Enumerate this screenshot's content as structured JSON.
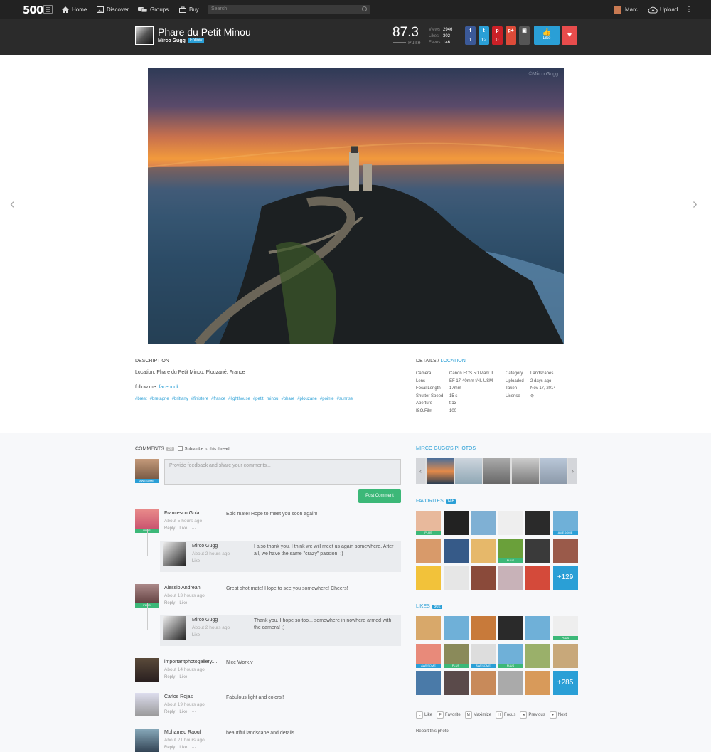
{
  "nav": {
    "logo": "500",
    "items": [
      "Home",
      "Discover",
      "Groups",
      "Buy"
    ],
    "search_placeholder": "Search",
    "user": "Marc",
    "upload": "Upload"
  },
  "photo": {
    "title": "Phare du Petit Minou",
    "author": "Mirco Gugg",
    "follow": "Follow",
    "pulse": "87.3",
    "pulse_label": "Pulse",
    "stats": [
      {
        "label": "Views",
        "value": "2946"
      },
      {
        "label": "Likes",
        "value": "302"
      },
      {
        "label": "Faves",
        "value": "146"
      }
    ],
    "share": [
      {
        "icon": "facebook-icon",
        "symbol": "f",
        "count": "1",
        "color": "#3b5998"
      },
      {
        "icon": "twitter-icon",
        "symbol": "t",
        "count": "12",
        "color": "#2a9fd6"
      },
      {
        "icon": "pinterest-icon",
        "symbol": "p",
        "count": "0",
        "color": "#cb2027"
      },
      {
        "icon": "googleplus-icon",
        "symbol": "g+",
        "count": "",
        "color": "#dd4b39"
      },
      {
        "icon": "embed-icon",
        "symbol": "▣",
        "count": "",
        "color": "#555"
      }
    ],
    "like": "Like",
    "watermark": "©Mirco Gugg"
  },
  "description": {
    "heading": "DESCRIPTION",
    "location": "Location: Phare du Petit Minou, Plouzané, France",
    "follow_prefix": "follow me: ",
    "follow_link": "facebook",
    "tags": [
      "#brest",
      "#bretagne",
      "#brittany",
      "#finistere",
      "#france",
      "#lighthouse",
      "#petit minou",
      "#phare",
      "#plouzane",
      "#pointe",
      "#sunrise"
    ]
  },
  "details": {
    "heading": "DETAILS / ",
    "heading_link": "LOCATION",
    "left_labels": [
      "Camera",
      "Lens",
      "Focal Length",
      "Shutter Speed",
      "Aperture",
      "ISO/Film"
    ],
    "left_values": [
      "Canon EOS 5D Mark II",
      "EF 17-40mm f/4L USM",
      "17mm",
      "15 s",
      "f/13",
      "100"
    ],
    "right_labels": [
      "Category",
      "Uploaded",
      "Taken",
      "License"
    ],
    "right_values": [
      "Landscapes",
      "2 days ago",
      "Nov 17, 2014",
      "⊜"
    ]
  },
  "comments": {
    "heading": "COMMENTS",
    "count": "20",
    "subscribe": "Subscribe to this thread",
    "placeholder": "Provide feedback and share your comments...",
    "post": "Post Comment",
    "list": [
      {
        "name": "Francesco Gola",
        "time": "About 5 hours ago",
        "text": "Epic mate! Hope to meet you soon again!",
        "badge": "PLUS"
      },
      {
        "name": "Mirco Gugg",
        "time": "About 2 hours ago",
        "text": "I also thank you. I think we will meet us again somewhere. After all, we have the same \"crazy\" passion. ;)",
        "reply": true
      },
      {
        "name": "Alessio Andreani",
        "time": "About 13 hours ago",
        "text": "Great shot mate! Hope to see you somewhere! Cheers!",
        "badge": "PLUS"
      },
      {
        "name": "Mirco Gugg",
        "time": "About 2 hours ago",
        "text": "Thank you. I hope so too... somewhere in nowhere armed with the camera! ;)",
        "reply": true
      },
      {
        "name": "importantphotogallery....",
        "time": "About 14 hours ago",
        "text": "Nice Work.v"
      },
      {
        "name": "Carlos Rojas",
        "time": "About 19 hours ago",
        "text": "Fabulous light and colors!!"
      },
      {
        "name": "Mohamed Raouf",
        "time": "About 21 hours ago",
        "text": "beautiful landscape and details"
      }
    ],
    "actions": [
      "Reply",
      "Like",
      "···"
    ],
    "reply_actions": [
      "Like",
      "···"
    ],
    "my_badge": "AWESOME"
  },
  "sidebar": {
    "author_photos": "MIRCO GUGG'S PHOTOS",
    "favorites": "FAVORITES",
    "favorites_count": "146",
    "favorites_more": "+129",
    "likes": "LIKES",
    "likes_count": "302",
    "likes_more": "+285",
    "shortcuts": [
      {
        "key": "L",
        "label": "Like"
      },
      {
        "key": "F",
        "label": "Favorite"
      },
      {
        "key": "M",
        "label": "Maximize"
      },
      {
        "key": "H",
        "label": "Focus"
      },
      {
        "key": "◂",
        "label": "Previous"
      },
      {
        "key": "▸",
        "label": "Next"
      }
    ],
    "report": "Report this photo"
  }
}
